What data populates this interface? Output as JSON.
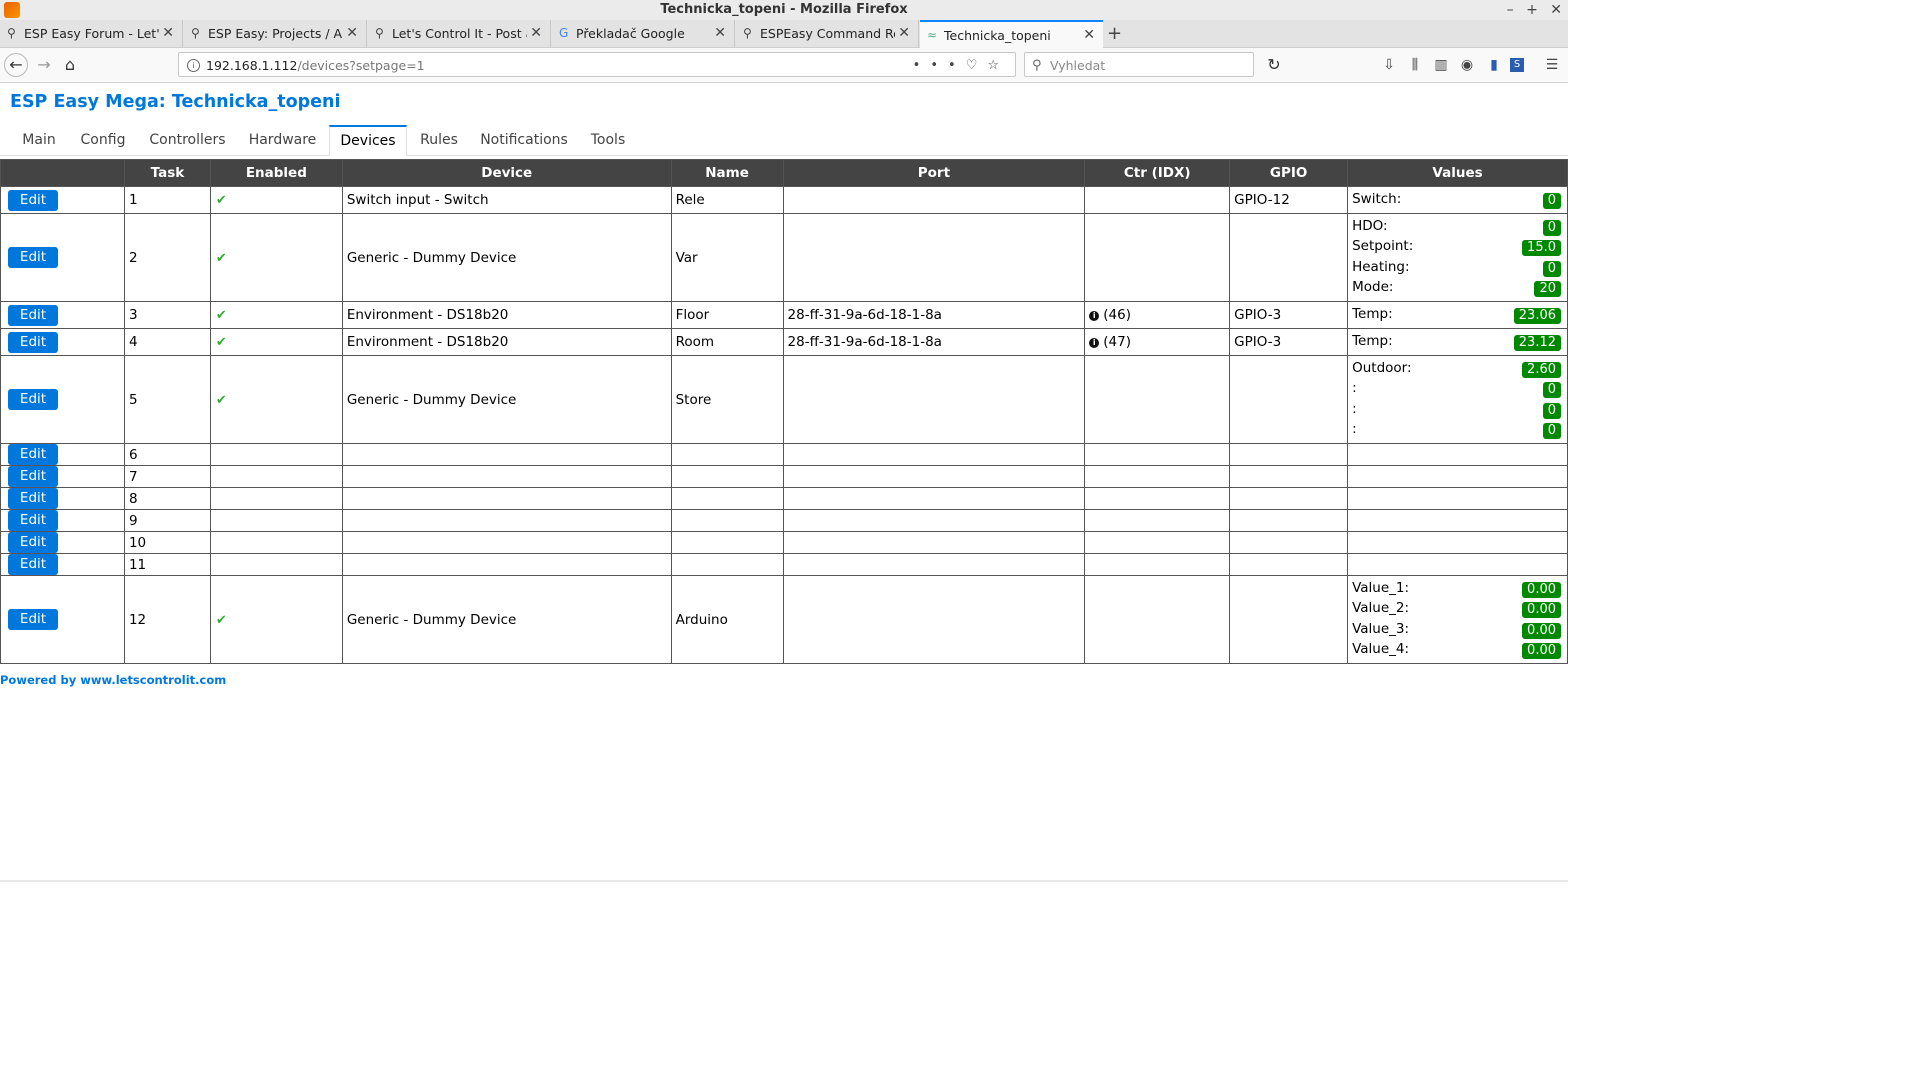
{
  "window": {
    "title": "Technicka_topeni - Mozilla Firefox",
    "controls": [
      "–",
      "+",
      "✕"
    ]
  },
  "tabs": [
    {
      "label": "ESP Easy Forum - Let's Control It",
      "icon": "letscontrolit-icon"
    },
    {
      "label": "ESP Easy: Projects / Applications",
      "icon": "letscontrolit-icon"
    },
    {
      "label": "Let's Control It - Post a reply",
      "icon": "letscontrolit-icon"
    },
    {
      "label": "Překladač Google",
      "icon": "google-translate-icon"
    },
    {
      "label": "ESPEasy Command Reference",
      "icon": "letscontrolit-icon"
    },
    {
      "label": "Technicka_topeni",
      "icon": "espeasy-icon",
      "active": true
    }
  ],
  "navbar": {
    "url_host": "192.168.1.112",
    "url_path": "/devices?setpage=1",
    "search_placeholder": "Vyhledat"
  },
  "page": {
    "title": "ESP Easy Mega: Technicka_topeni",
    "menu": [
      "Main",
      "Config",
      "Controllers",
      "Hardware",
      "Devices",
      "Rules",
      "Notifications",
      "Tools"
    ],
    "active_menu": "Devices",
    "table": {
      "headers": [
        "",
        "Task",
        "Enabled",
        "Device",
        "Name",
        "Port",
        "Ctr (IDX)",
        "GPIO",
        "Values"
      ],
      "edit_label": "Edit",
      "check_mark": "✔",
      "ctr_icon_glyph": "i",
      "rows": [
        {
          "task": "1",
          "enabled": true,
          "device": "Switch input - Switch",
          "name": "Rele",
          "port": "",
          "ctr": "",
          "gpio": "GPIO-12",
          "values": [
            {
              "name": "Switch:",
              "value": "0"
            }
          ]
        },
        {
          "task": "2",
          "enabled": true,
          "device": "Generic - Dummy Device",
          "name": "Var",
          "port": "",
          "ctr": "",
          "gpio": "",
          "values": [
            {
              "name": "HDO:",
              "value": "0"
            },
            {
              "name": "Setpoint:",
              "value": "15.0"
            },
            {
              "name": "Heating:",
              "value": "0"
            },
            {
              "name": "Mode:",
              "value": "20"
            }
          ]
        },
        {
          "task": "3",
          "enabled": true,
          "device": "Environment - DS18b20",
          "name": "Floor",
          "port": "28-ff-31-9a-6d-18-1-8a",
          "ctr": "(46)",
          "gpio": "GPIO-3",
          "values": [
            {
              "name": "Temp:",
              "value": "23.06"
            }
          ]
        },
        {
          "task": "4",
          "enabled": true,
          "device": "Environment - DS18b20",
          "name": "Room",
          "port": "28-ff-31-9a-6d-18-1-8a",
          "ctr": "(47)",
          "gpio": "GPIO-3",
          "values": [
            {
              "name": "Temp:",
              "value": "23.12"
            }
          ]
        },
        {
          "task": "5",
          "enabled": true,
          "device": "Generic - Dummy Device",
          "name": "Store",
          "port": "",
          "ctr": "",
          "gpio": "",
          "values": [
            {
              "name": "Outdoor:",
              "value": "2.60"
            },
            {
              "name": ":",
              "value": "0"
            },
            {
              "name": ":",
              "value": "0"
            },
            {
              "name": ":",
              "value": "0"
            }
          ]
        },
        {
          "task": "6",
          "enabled": false,
          "device": "",
          "name": "",
          "port": "",
          "ctr": "",
          "gpio": "",
          "values": []
        },
        {
          "task": "7",
          "enabled": false,
          "device": "",
          "name": "",
          "port": "",
          "ctr": "",
          "gpio": "",
          "values": []
        },
        {
          "task": "8",
          "enabled": false,
          "device": "",
          "name": "",
          "port": "",
          "ctr": "",
          "gpio": "",
          "values": []
        },
        {
          "task": "9",
          "enabled": false,
          "device": "",
          "name": "",
          "port": "",
          "ctr": "",
          "gpio": "",
          "values": []
        },
        {
          "task": "10",
          "enabled": false,
          "device": "",
          "name": "",
          "port": "",
          "ctr": "",
          "gpio": "",
          "values": []
        },
        {
          "task": "11",
          "enabled": false,
          "device": "",
          "name": "",
          "port": "",
          "ctr": "",
          "gpio": "",
          "values": []
        },
        {
          "task": "12",
          "enabled": true,
          "device": "Generic - Dummy Device",
          "name": "Arduino",
          "port": "",
          "ctr": "",
          "gpio": "",
          "values": [
            {
              "name": "Value_1:",
              "value": "0.00"
            },
            {
              "name": "Value_2:",
              "value": "0.00"
            },
            {
              "name": "Value_3:",
              "value": "0.00"
            },
            {
              "name": "Value_4:",
              "value": "0.00"
            }
          ]
        }
      ]
    },
    "footer": "Powered by www.letscontrolit.com"
  },
  "colors": {
    "accent": "#0077dd",
    "badge": "#008800",
    "header_bg": "#444444",
    "check": "#33aa33"
  }
}
